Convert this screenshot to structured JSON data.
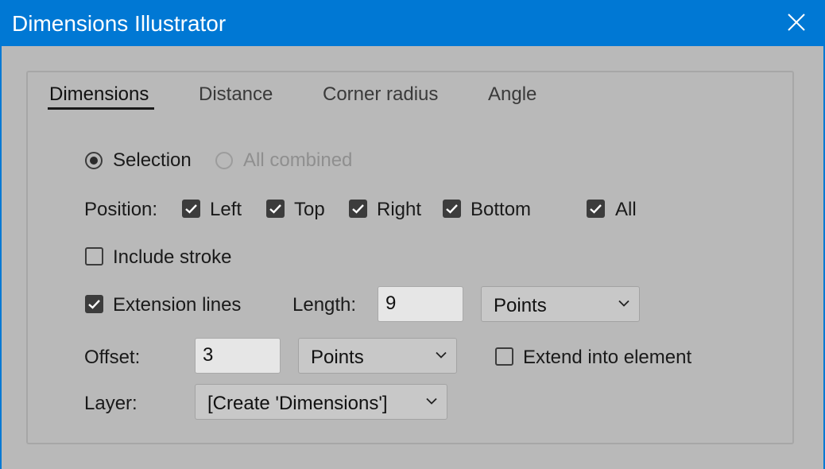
{
  "window": {
    "title": "Dimensions Illustrator"
  },
  "tabs": [
    {
      "label": "Dimensions",
      "active": true
    },
    {
      "label": "Distance",
      "active": false
    },
    {
      "label": "Corner radius",
      "active": false
    },
    {
      "label": "Angle",
      "active": false
    }
  ],
  "scope": {
    "selection_label": "Selection",
    "selection_selected": true,
    "all_combined_label": "All combined",
    "all_combined_enabled": false
  },
  "position": {
    "label": "Position:",
    "left_label": "Left",
    "left_checked": true,
    "top_label": "Top",
    "top_checked": true,
    "right_label": "Right",
    "right_checked": true,
    "bottom_label": "Bottom",
    "bottom_checked": true,
    "all_label": "All",
    "all_checked": true
  },
  "include_stroke": {
    "label": "Include stroke",
    "checked": false
  },
  "extension_lines": {
    "label": "Extension lines",
    "checked": true,
    "length_label": "Length:",
    "length_value": "9",
    "length_unit": "Points"
  },
  "offset": {
    "label": "Offset:",
    "value": "3",
    "unit": "Points",
    "extend_into_element_label": "Extend into element",
    "extend_into_element_checked": false
  },
  "layer": {
    "label": "Layer:",
    "value": "[Create 'Dimensions']"
  },
  "colors": {
    "titlebar": "#0078d4",
    "dialog_bg": "#b9b9b9",
    "checkbox_fill": "#3c3c3c"
  }
}
